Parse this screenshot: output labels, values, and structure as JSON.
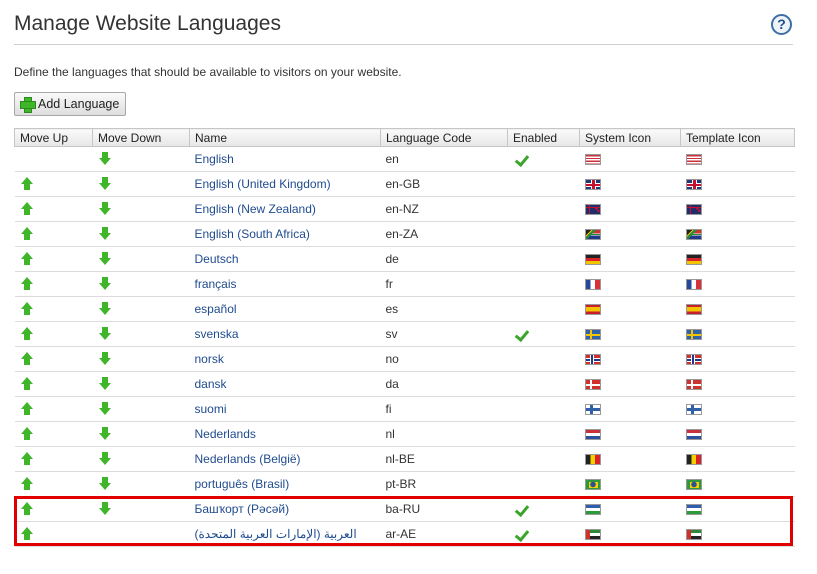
{
  "header": {
    "title": "Manage Website Languages",
    "help_icon": "?"
  },
  "description": "Define the languages that should be available to visitors on your website.",
  "toolbar": {
    "add_label": "Add Language",
    "add_icon": "plus-icon"
  },
  "table": {
    "columns": [
      "Move Up",
      "Move Down",
      "Name",
      "Language Code",
      "Enabled",
      "System Icon",
      "Template Icon"
    ],
    "rows": [
      {
        "name": "English",
        "code": "en",
        "enabled": true,
        "up": false,
        "down": true,
        "flag": "us"
      },
      {
        "name": "English (United Kingdom)",
        "code": "en-GB",
        "enabled": false,
        "up": true,
        "down": true,
        "flag": "gb"
      },
      {
        "name": "English (New Zealand)",
        "code": "en-NZ",
        "enabled": false,
        "up": true,
        "down": true,
        "flag": "nz"
      },
      {
        "name": "English (South Africa)",
        "code": "en-ZA",
        "enabled": false,
        "up": true,
        "down": true,
        "flag": "za"
      },
      {
        "name": "Deutsch",
        "code": "de",
        "enabled": false,
        "up": true,
        "down": true,
        "flag": "de"
      },
      {
        "name": "français",
        "code": "fr",
        "enabled": false,
        "up": true,
        "down": true,
        "flag": "fr"
      },
      {
        "name": "español",
        "code": "es",
        "enabled": false,
        "up": true,
        "down": true,
        "flag": "es"
      },
      {
        "name": "svenska",
        "code": "sv",
        "enabled": true,
        "up": true,
        "down": true,
        "flag": "se"
      },
      {
        "name": "norsk",
        "code": "no",
        "enabled": false,
        "up": true,
        "down": true,
        "flag": "no"
      },
      {
        "name": "dansk",
        "code": "da",
        "enabled": false,
        "up": true,
        "down": true,
        "flag": "dk"
      },
      {
        "name": "suomi",
        "code": "fi",
        "enabled": false,
        "up": true,
        "down": true,
        "flag": "fi"
      },
      {
        "name": "Nederlands",
        "code": "nl",
        "enabled": false,
        "up": true,
        "down": true,
        "flag": "nl"
      },
      {
        "name": "Nederlands (België)",
        "code": "nl-BE",
        "enabled": false,
        "up": true,
        "down": true,
        "flag": "be"
      },
      {
        "name": "português (Brasil)",
        "code": "pt-BR",
        "enabled": false,
        "up": true,
        "down": true,
        "flag": "br"
      },
      {
        "name": "Башҡорт (Рәсәй)",
        "code": "ba-RU",
        "enabled": true,
        "up": true,
        "down": true,
        "flag": "ba"
      },
      {
        "name": "العربية (الإمارات العربية المتحدة)",
        "code": "ar-AE",
        "enabled": true,
        "up": true,
        "down": false,
        "flag": "ae"
      }
    ]
  },
  "colors": {
    "link": "#1f4b8e",
    "arrow": "#3fb52a",
    "check": "#3aa52a",
    "highlight": "#e00000"
  }
}
